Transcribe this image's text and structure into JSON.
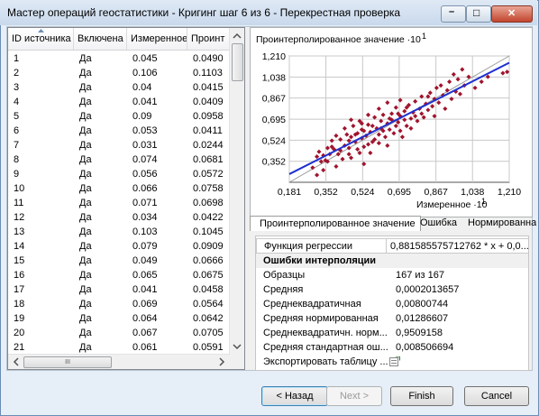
{
  "window": {
    "title": "Мастер операций геостатистики - Кригинг шаг 6 из 6 - Перекрестная проверка",
    "minimize_glyph": "–",
    "maximize_glyph": "□",
    "close_glyph": "✕"
  },
  "table": {
    "columns": [
      "ID источника",
      "Включена",
      "Измеренное",
      "Проинт"
    ],
    "rows": [
      [
        "1",
        "Да",
        "0.045",
        "0.0490"
      ],
      [
        "2",
        "Да",
        "0.106",
        "0.1103"
      ],
      [
        "3",
        "Да",
        "0.04",
        "0.0415"
      ],
      [
        "4",
        "Да",
        "0.041",
        "0.0409"
      ],
      [
        "5",
        "Да",
        "0.09",
        "0.0958"
      ],
      [
        "6",
        "Да",
        "0.053",
        "0.0411"
      ],
      [
        "7",
        "Да",
        "0.031",
        "0.0244"
      ],
      [
        "8",
        "Да",
        "0.074",
        "0.0681"
      ],
      [
        "9",
        "Да",
        "0.056",
        "0.0572"
      ],
      [
        "10",
        "Да",
        "0.066",
        "0.0758"
      ],
      [
        "11",
        "Да",
        "0.071",
        "0.0698"
      ],
      [
        "12",
        "Да",
        "0.034",
        "0.0422"
      ],
      [
        "13",
        "Да",
        "0.103",
        "0.1045"
      ],
      [
        "14",
        "Да",
        "0.079",
        "0.0909"
      ],
      [
        "15",
        "Да",
        "0.049",
        "0.0666"
      ],
      [
        "16",
        "Да",
        "0.065",
        "0.0675"
      ],
      [
        "17",
        "Да",
        "0.041",
        "0.0458"
      ],
      [
        "18",
        "Да",
        "0.069",
        "0.0564"
      ],
      [
        "19",
        "Да",
        "0.064",
        "0.0642"
      ],
      [
        "20",
        "Да",
        "0.067",
        "0.0705"
      ],
      [
        "21",
        "Да",
        "0.061",
        "0.0591"
      ]
    ],
    "hscroll_grip": "III"
  },
  "chart_data": {
    "type": "scatter",
    "ylabel": "Проинтерполированное значение ·10",
    "ylabel_exp": "1",
    "xlabel": "Измеренное ·10",
    "xlabel_exp": "1",
    "xticks": [
      "0,181",
      "0,352",
      "0,524",
      "0,695",
      "0,867",
      "1,038",
      "1,210"
    ],
    "yticks": [
      "1,210",
      "1,038",
      "0,867",
      "0,695",
      "0,524",
      "0,352"
    ],
    "xlim": [
      0.181,
      1.21
    ],
    "ylim": [
      0.181,
      1.21
    ],
    "grid": true,
    "regression": {
      "slope": 0.8815855757,
      "intercept": 0.0,
      "color": "#1e2fd0"
    },
    "reference_line_color": "#9a9a9a",
    "point_color": "#a0142d",
    "points": [
      [
        0.31,
        0.24
      ],
      [
        0.31,
        0.39
      ],
      [
        0.32,
        0.43
      ],
      [
        0.34,
        0.4
      ],
      [
        0.34,
        0.28
      ],
      [
        0.35,
        0.36
      ],
      [
        0.36,
        0.46
      ],
      [
        0.36,
        0.35
      ],
      [
        0.38,
        0.47
      ],
      [
        0.38,
        0.52
      ],
      [
        0.39,
        0.45
      ],
      [
        0.4,
        0.31
      ],
      [
        0.41,
        0.41
      ],
      [
        0.42,
        0.53
      ],
      [
        0.43,
        0.37
      ],
      [
        0.44,
        0.48
      ],
      [
        0.44,
        0.62
      ],
      [
        0.45,
        0.57
      ],
      [
        0.46,
        0.46
      ],
      [
        0.46,
        0.41
      ],
      [
        0.47,
        0.38
      ],
      [
        0.47,
        0.55
      ],
      [
        0.48,
        0.64
      ],
      [
        0.49,
        0.51
      ],
      [
        0.5,
        0.58
      ],
      [
        0.5,
        0.45
      ],
      [
        0.51,
        0.42
      ],
      [
        0.51,
        0.68
      ],
      [
        0.52,
        0.54
      ],
      [
        0.52,
        0.61
      ],
      [
        0.53,
        0.47
      ],
      [
        0.53,
        0.33
      ],
      [
        0.54,
        0.56
      ],
      [
        0.55,
        0.65
      ],
      [
        0.55,
        0.49
      ],
      [
        0.56,
        0.59
      ],
      [
        0.56,
        0.42
      ],
      [
        0.57,
        0.64
      ],
      [
        0.58,
        0.53
      ],
      [
        0.58,
        0.71
      ],
      [
        0.59,
        0.62
      ],
      [
        0.6,
        0.57
      ],
      [
        0.6,
        0.5
      ],
      [
        0.61,
        0.68
      ],
      [
        0.62,
        0.6
      ],
      [
        0.62,
        0.73
      ],
      [
        0.63,
        0.55
      ],
      [
        0.64,
        0.66
      ],
      [
        0.64,
        0.48
      ],
      [
        0.65,
        0.61
      ],
      [
        0.66,
        0.74
      ],
      [
        0.66,
        0.69
      ],
      [
        0.67,
        0.58
      ],
      [
        0.68,
        0.64
      ],
      [
        0.68,
        0.79
      ],
      [
        0.69,
        0.67
      ],
      [
        0.7,
        0.72
      ],
      [
        0.7,
        0.6
      ],
      [
        0.71,
        0.55
      ],
      [
        0.72,
        0.76
      ],
      [
        0.72,
        0.69
      ],
      [
        0.73,
        0.64
      ],
      [
        0.74,
        0.81
      ],
      [
        0.75,
        0.7
      ],
      [
        0.75,
        0.62
      ],
      [
        0.76,
        0.75
      ],
      [
        0.77,
        0.84
      ],
      [
        0.78,
        0.68
      ],
      [
        0.79,
        0.78
      ],
      [
        0.8,
        0.74
      ],
      [
        0.8,
        0.88
      ],
      [
        0.81,
        0.71
      ],
      [
        0.82,
        0.82
      ],
      [
        0.83,
        0.77
      ],
      [
        0.84,
        0.91
      ],
      [
        0.85,
        0.8
      ],
      [
        0.86,
        0.72
      ],
      [
        0.86,
        0.86
      ],
      [
        0.87,
        0.95
      ],
      [
        0.88,
        0.83
      ],
      [
        0.9,
        0.89
      ],
      [
        0.91,
        0.78
      ],
      [
        0.92,
        0.93
      ],
      [
        0.93,
        1.0
      ],
      [
        0.94,
        0.86
      ],
      [
        0.96,
        0.92
      ],
      [
        0.97,
        1.02
      ],
      [
        0.98,
        0.9
      ],
      [
        1.0,
        0.97
      ],
      [
        1.02,
        1.04
      ],
      [
        1.05,
        0.95
      ],
      [
        1.08,
        1.0
      ],
      [
        1.11,
        1.04
      ],
      [
        1.18,
        1.07
      ],
      [
        1.2,
        1.08
      ],
      [
        0.4,
        0.56
      ],
      [
        0.33,
        0.35
      ],
      [
        0.29,
        0.3
      ],
      [
        0.37,
        0.41
      ],
      [
        0.42,
        0.44
      ],
      [
        0.46,
        0.52
      ],
      [
        0.49,
        0.57
      ],
      [
        0.53,
        0.6
      ],
      [
        0.57,
        0.51
      ],
      [
        0.61,
        0.62
      ],
      [
        0.65,
        0.7
      ],
      [
        0.69,
        0.74
      ],
      [
        0.73,
        0.79
      ],
      [
        0.77,
        0.72
      ],
      [
        0.83,
        0.88
      ],
      [
        0.89,
        0.97
      ],
      [
        0.95,
        1.06
      ],
      [
        0.99,
        1.1
      ],
      [
        0.6,
        0.78
      ],
      [
        0.64,
        0.83
      ],
      [
        0.55,
        0.73
      ],
      [
        0.47,
        0.69
      ],
      [
        0.7,
        0.85
      ],
      [
        0.52,
        0.66
      ]
    ]
  },
  "tabs": {
    "items": [
      "Проинтерполированное значение",
      "Ошибка",
      "Нормированна"
    ]
  },
  "properties": {
    "regression_label": "Функция регрессии",
    "regression_value": "0,881585575712762 * x + 0,0...",
    "section_header": "Ошибки интерполяции",
    "rows": [
      {
        "key": "Образцы",
        "value": "167 из 167"
      },
      {
        "key": "Средняя",
        "value": "0,0002013657"
      },
      {
        "key": "Среднеквадратичная",
        "value": "0,00800744"
      },
      {
        "key": "Средняя нормированная",
        "value": "0,01286607"
      },
      {
        "key": "Среднеквадратичн. норм...",
        "value": "0,9509158"
      },
      {
        "key": "Средняя стандартная ош...",
        "value": "0,008506694"
      }
    ],
    "export_label": "Экспортировать таблицу ..."
  },
  "buttons": {
    "back": "< Назад",
    "next": "Next >",
    "finish": "Finish",
    "cancel": "Cancel"
  }
}
